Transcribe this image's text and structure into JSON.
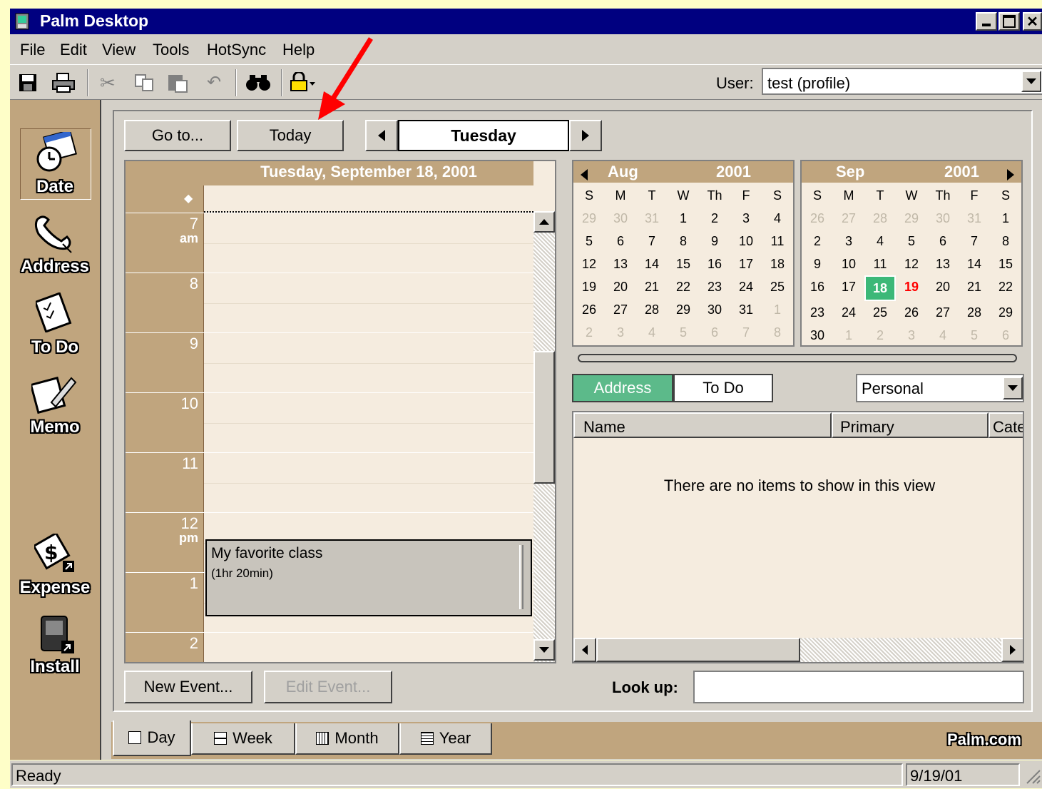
{
  "window": {
    "title": "Palm Desktop"
  },
  "menu": [
    "File",
    "Edit",
    "View",
    "Tools",
    "HotSync",
    "Help"
  ],
  "toolbar": {
    "user_label": "User:",
    "user_value": "test (profile)"
  },
  "sidebar": {
    "items": [
      "Date",
      "Address",
      "To Do",
      "Memo",
      "Expense",
      "Install"
    ]
  },
  "day_nav": {
    "goto": "Go to...",
    "today": "Today",
    "day_name": "Tuesday"
  },
  "day_view": {
    "header": "Tuesday, September 18, 2001",
    "hours": [
      {
        "h": "7",
        "ap": "am"
      },
      {
        "h": "8",
        "ap": ""
      },
      {
        "h": "9",
        "ap": ""
      },
      {
        "h": "10",
        "ap": ""
      },
      {
        "h": "11",
        "ap": ""
      },
      {
        "h": "12",
        "ap": "pm"
      },
      {
        "h": "1",
        "ap": ""
      },
      {
        "h": "2",
        "ap": ""
      }
    ],
    "event": {
      "title": "My favorite class",
      "duration": "(1hr 20min)"
    },
    "untimed_marker": "◆"
  },
  "buttons": {
    "new_event": "New Event...",
    "edit_event": "Edit Event..."
  },
  "calendars": [
    {
      "month": "Aug",
      "year": "2001",
      "days": [
        "S",
        "M",
        "T",
        "W",
        "Th",
        "F",
        "S"
      ],
      "weeks": [
        [
          "29",
          "30",
          "31",
          "1",
          "2",
          "3",
          "4"
        ],
        [
          "5",
          "6",
          "7",
          "8",
          "9",
          "10",
          "11"
        ],
        [
          "12",
          "13",
          "14",
          "15",
          "16",
          "17",
          "18"
        ],
        [
          "19",
          "20",
          "21",
          "22",
          "23",
          "24",
          "25"
        ],
        [
          "26",
          "27",
          "28",
          "29",
          "30",
          "31",
          "1"
        ],
        [
          "2",
          "3",
          "4",
          "5",
          "6",
          "7",
          "8"
        ]
      ],
      "dim": [
        [
          1,
          1,
          1,
          0,
          0,
          0,
          0
        ],
        [
          0,
          0,
          0,
          0,
          0,
          0,
          0
        ],
        [
          0,
          0,
          0,
          0,
          0,
          0,
          0
        ],
        [
          0,
          0,
          0,
          0,
          0,
          0,
          0
        ],
        [
          0,
          0,
          0,
          0,
          0,
          0,
          1
        ],
        [
          1,
          1,
          1,
          1,
          1,
          1,
          1
        ]
      ]
    },
    {
      "month": "Sep",
      "year": "2001",
      "days": [
        "S",
        "M",
        "T",
        "W",
        "Th",
        "F",
        "S"
      ],
      "weeks": [
        [
          "26",
          "27",
          "28",
          "29",
          "30",
          "31",
          "1"
        ],
        [
          "2",
          "3",
          "4",
          "5",
          "6",
          "7",
          "8"
        ],
        [
          "9",
          "10",
          "11",
          "12",
          "13",
          "14",
          "15"
        ],
        [
          "16",
          "17",
          "18",
          "19",
          "20",
          "21",
          "22"
        ],
        [
          "23",
          "24",
          "25",
          "26",
          "27",
          "28",
          "29"
        ],
        [
          "30",
          "1",
          "2",
          "3",
          "4",
          "5",
          "6"
        ]
      ],
      "dim": [
        [
          1,
          1,
          1,
          1,
          1,
          1,
          0
        ],
        [
          0,
          0,
          0,
          0,
          0,
          0,
          0
        ],
        [
          0,
          0,
          0,
          0,
          0,
          0,
          0
        ],
        [
          0,
          0,
          0,
          0,
          0,
          0,
          0
        ],
        [
          0,
          0,
          0,
          0,
          0,
          0,
          0
        ],
        [
          0,
          1,
          1,
          1,
          1,
          1,
          1
        ]
      ]
    }
  ],
  "lists": {
    "tab_address": "Address",
    "tab_todo": "To Do",
    "category": "Personal",
    "columns": [
      "Name",
      "Primary",
      "Cate"
    ],
    "empty_msg": "There are no items to show in this view"
  },
  "lookup": {
    "label": "Look up:",
    "value": ""
  },
  "view_tabs": [
    "Day",
    "Week",
    "Month",
    "Year"
  ],
  "brand": "Palm.com",
  "status": {
    "left": "Ready",
    "date": "9/19/01"
  },
  "colors": {
    "titlebar": "#000080",
    "tan": "#c0a57e",
    "beige": "#f5ecdf",
    "selected_day": "#3cb878",
    "highlight_red": "#ff0000",
    "address_tab": "#5cba8a"
  }
}
